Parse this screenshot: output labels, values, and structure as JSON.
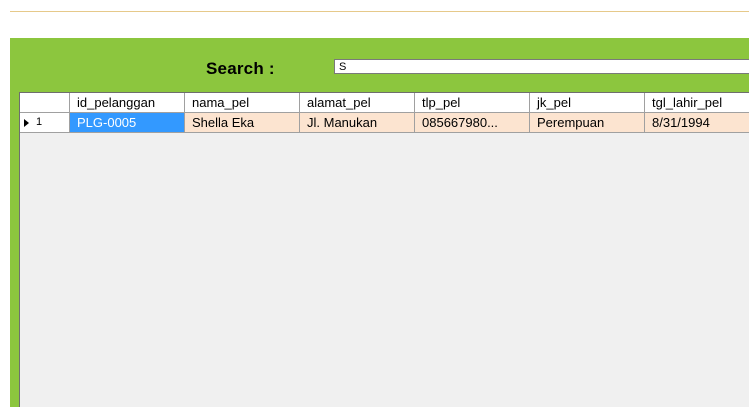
{
  "search": {
    "label": "Search  :",
    "value": "S"
  },
  "table": {
    "columns": [
      "id_pelanggan",
      "nama_pel",
      "alamat_pel",
      "tlp_pel",
      "jk_pel",
      "tgl_lahir_pel"
    ],
    "rows": [
      {
        "number": "1",
        "cells": [
          "PLG-0005",
          "Shella Eka",
          "Jl. Manukan",
          "085667980...",
          "Perempuan",
          "8/31/1994"
        ]
      }
    ]
  },
  "colors": {
    "panel": "#8cc63e",
    "grid_background": "#f0f0f0",
    "row_background": "#fce4d0",
    "selected_cell": "#3399ff"
  },
  "icons": {
    "row_indicator": "current-row-arrow-icon"
  }
}
